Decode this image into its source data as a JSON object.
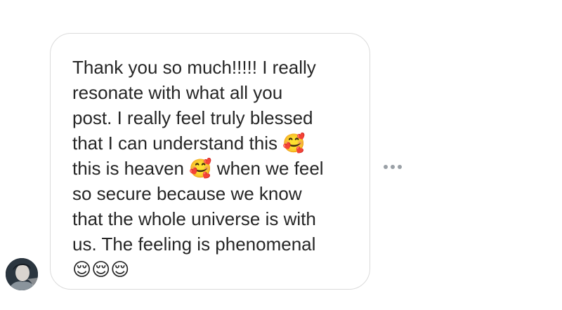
{
  "message": {
    "text": "Thank you so much!!!!! I really\nresonate with what all you\npost. I really feel truly blessed\nthat I can understand this 🥰\nthis is heaven 🥰 when we feel\nso secure because we know\nthat the whole universe is with\nus. The feeling is phenomenal\n😌😌😌"
  },
  "icons": {
    "top_more": "more-horizontal-icon",
    "message_more": "more-horizontal-icon",
    "avatar": "user-avatar"
  },
  "colors": {
    "bubble_border": "#dbdbdb",
    "text": "#262626",
    "dots": "#9aa0a6"
  }
}
